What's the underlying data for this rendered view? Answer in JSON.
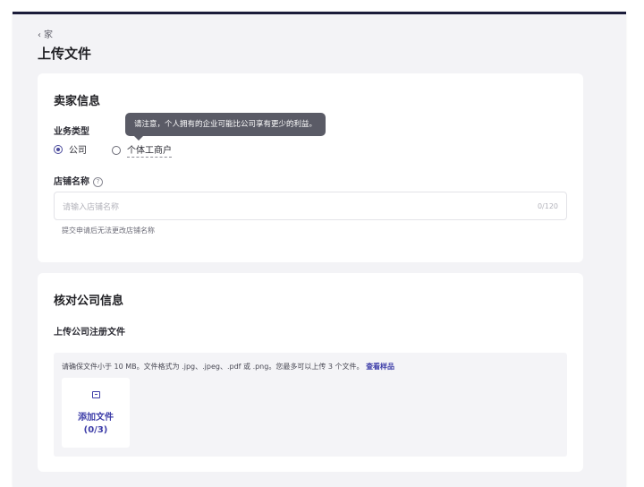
{
  "header": {
    "back_label": "家",
    "page_title": "上传文件"
  },
  "seller_info": {
    "title": "卖家信息",
    "business_type_label": "业务类型",
    "options": [
      {
        "label": "公司",
        "selected": true
      },
      {
        "label": "个体工商户",
        "selected": false
      }
    ],
    "tooltip": "请注意，个人拥有的企业可能比公司享有更少的利益。",
    "store_name_label": "店铺名称",
    "store_name_placeholder": "请输入店铺名称",
    "store_name_counter": "0/120",
    "store_name_hint": "提交申请后无法更改店铺名称"
  },
  "company_verify": {
    "title": "核对公司信息",
    "upload_label": "上传公司注册文件",
    "upload_note": "请确保文件小于 10 MB。文件格式为 .jpg、.jpeg、.pdf 或 .png。您最多可以上传 3 个文件。",
    "sample_link": "查看样品",
    "add_file_label": "添加文件",
    "add_file_count": "(0/3)"
  },
  "colors": {
    "accent": "#3d3da8",
    "top_bar": "#1b1c3a",
    "page_bg": "#f3f3f6"
  }
}
